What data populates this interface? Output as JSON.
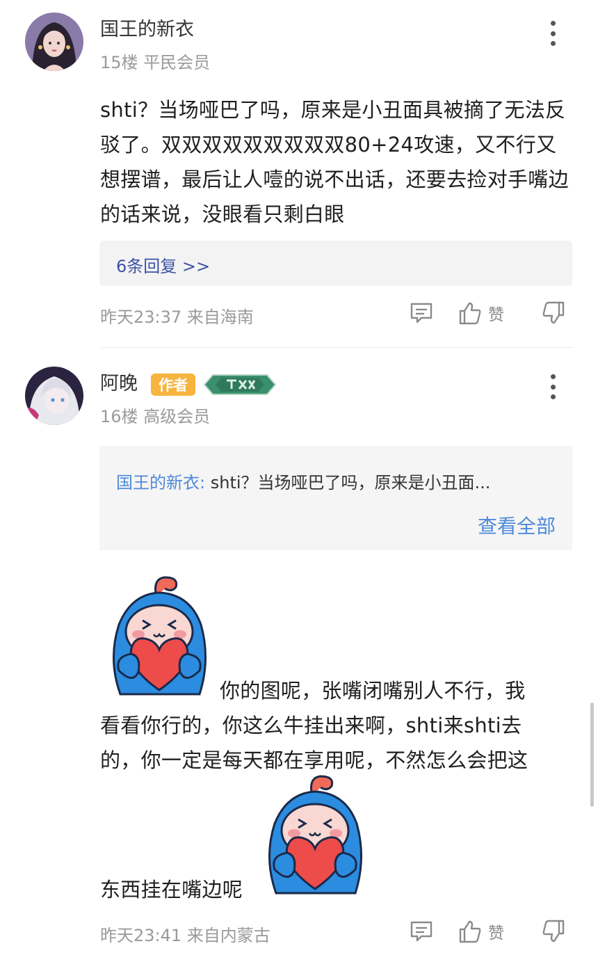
{
  "comments": [
    {
      "username": "国王的新衣",
      "floor": "15楼",
      "level": "平民会员",
      "body": "shti？当场哑巴了吗，原来是小丑面具被摘了无法反驳了。双双双双双双双双双80+24攻速，又不行又想摆谱，最后让人噎的说不出话，还要去捡对手嘴边的话来说，没眼看只剩白眼",
      "reply_count": "6条回复 >>",
      "time": "昨天23:37 来自海南",
      "like_label": "赞"
    },
    {
      "username": "阿晚",
      "author_badge": "作者",
      "floor": "16楼",
      "level": "高级会员",
      "quote_name": "国王的新衣:",
      "quote_text": "shti？当场哑巴了吗，原来是小丑面...",
      "view_all": "查看全部",
      "body_line1": "你的图呢，张嘴闭嘴别人不行，我",
      "body_line2": "看看你行的，你这么牛挂出来啊，shti来shti去",
      "body_line3": "的，你一定是每天都在享用呢，不然怎么会把这",
      "body_line4": "东西挂在嘴边呢",
      "time": "昨天23:41 来自内蒙古",
      "like_label": "赞"
    }
  ],
  "colors": {
    "link_blue": "#4e8ad8",
    "reply_blue": "#3c52a3",
    "author_badge": "#f7b43f",
    "level_badge": "#3a8f6e"
  },
  "icons": [
    "more-icon",
    "reply-icon",
    "thumb-up-icon",
    "thumb-down-icon",
    "sticker-heart-icon"
  ]
}
